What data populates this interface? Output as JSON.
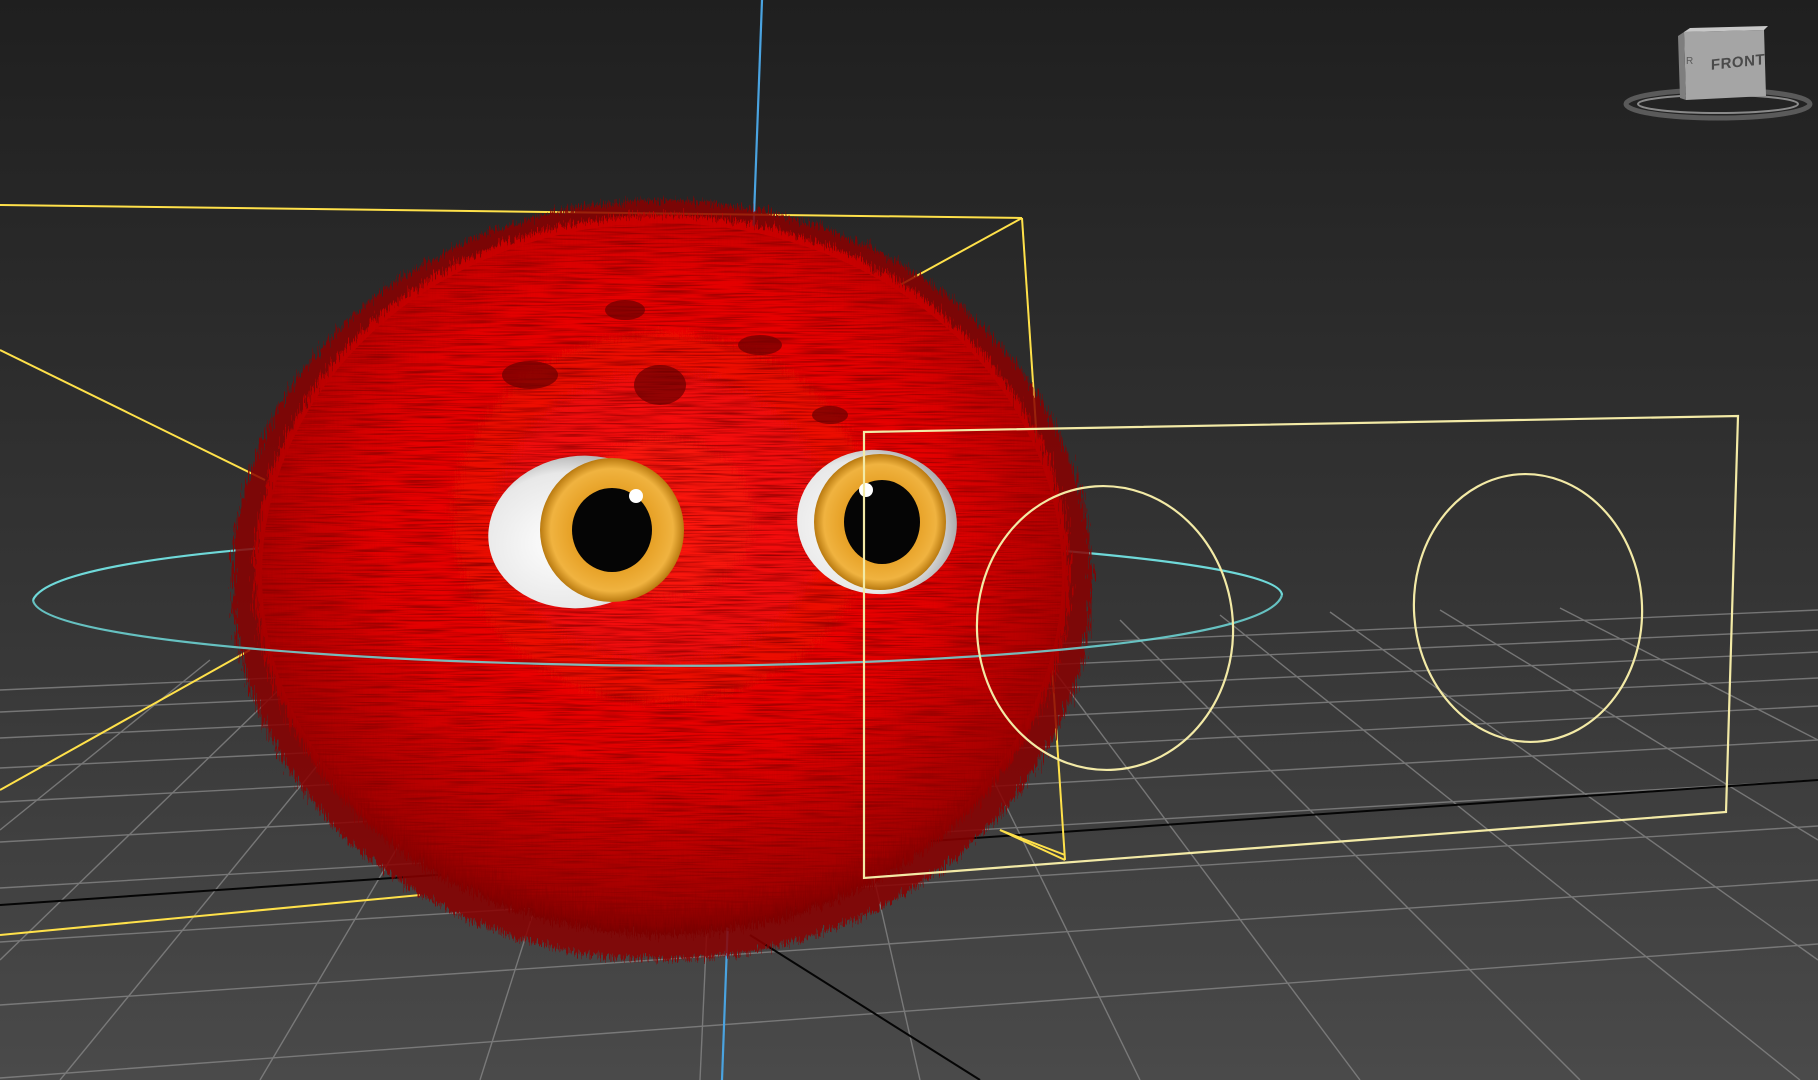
{
  "app": {
    "viewport_type": "perspective-3d-viewport"
  },
  "viewcube": {
    "face_label": "FRONT",
    "side_label": "R",
    "icon": "viewcube-icon"
  },
  "scene": {
    "background_top": "#1f1f1f",
    "background_bottom": "#4a4a4a",
    "grid_color": "#8a8a8a",
    "world_axis_y_color": "#4aa3e0",
    "spline_selection_color": "#ffe14a",
    "rig_ring_color": "#6fd9d9",
    "control_panel_color": "#f3eaa6",
    "creature_color": "#e30000",
    "iris_color": "#e39a1c",
    "icons": [
      "fuzzy-creature-mesh",
      "eye-left",
      "eye-right",
      "control-ring",
      "face-control-panel",
      "selection-bounding-box",
      "ground-grid",
      "world-axis"
    ]
  }
}
